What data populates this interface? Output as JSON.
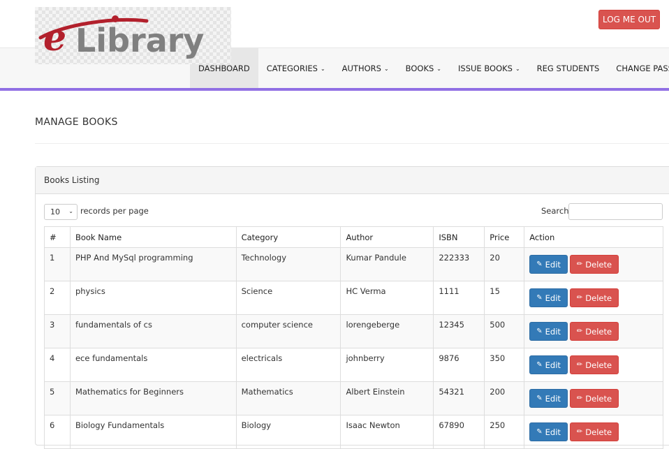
{
  "header": {
    "logo_text_e": "e",
    "logo_text_rest": "Library",
    "logout_label": "LOG ME OUT"
  },
  "nav": {
    "items": [
      {
        "label": "DASHBOARD",
        "dropdown": false,
        "active": true
      },
      {
        "label": "CATEGORIES",
        "dropdown": true,
        "active": false
      },
      {
        "label": "AUTHORS",
        "dropdown": true,
        "active": false
      },
      {
        "label": "BOOKS",
        "dropdown": true,
        "active": false
      },
      {
        "label": "ISSUE BOOKS",
        "dropdown": true,
        "active": false
      },
      {
        "label": "REG STUDENTS",
        "dropdown": false,
        "active": false
      },
      {
        "label": "CHANGE PASSWORD",
        "dropdown": false,
        "active": false
      }
    ],
    "caret": "⌄"
  },
  "page": {
    "title": "MANAGE BOOKS"
  },
  "panel": {
    "heading": "Books Listing",
    "length_value": "10",
    "length_label": "records per page",
    "search_label": "Search:",
    "search_value": ""
  },
  "table": {
    "columns": [
      "#",
      "Book Name",
      "Category",
      "Author",
      "ISBN",
      "Price",
      "Action"
    ],
    "rows": [
      [
        "1",
        "PHP And MySql programming",
        "Technology",
        "Kumar Pandule",
        "222333",
        "20"
      ],
      [
        "2",
        "physics",
        "Science",
        "HC Verma",
        "1111",
        "15"
      ],
      [
        "3",
        "fundamentals of cs",
        "computer science",
        "lorengeberge",
        "12345",
        "500"
      ],
      [
        "4",
        "ece fundamentals",
        "electricals",
        "johnberry",
        "9876",
        "350"
      ],
      [
        "5",
        "Mathematics for Beginners",
        "Mathematics",
        "Albert Einstein",
        "54321",
        "200"
      ],
      [
        "6",
        "Biology Fundamentals",
        "Biology",
        "Isaac Newton",
        "67890",
        "250"
      ]
    ],
    "edit_label": "Edit",
    "delete_label": "Delete"
  },
  "colors": {
    "accent": "#9170e4",
    "danger": "#d9534f",
    "primary": "#337ab7",
    "logo_red": "#b2202c",
    "logo_gray": "#808080"
  }
}
